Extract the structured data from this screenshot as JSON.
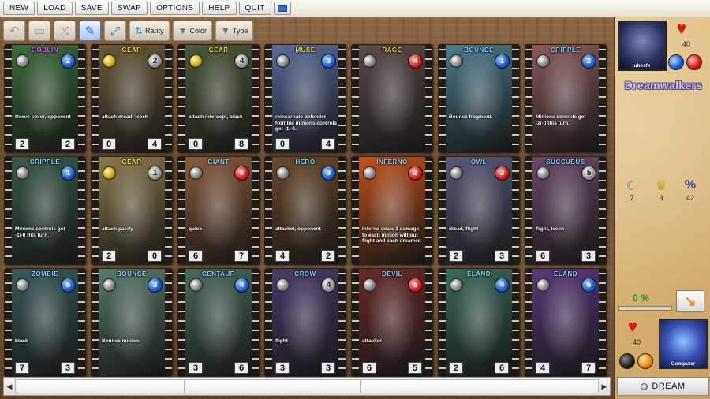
{
  "menu": [
    "NEW",
    "LOAD",
    "SAVE",
    "SWAP",
    "OPTIONS",
    "HELP",
    "QUIT"
  ],
  "toolbar": {
    "rarity_label": "Rarity",
    "color_label": "Color",
    "type_label": "Type"
  },
  "player": {
    "name": "ubesfx",
    "life": "40"
  },
  "opponent": {
    "name": "Computer",
    "life": "40"
  },
  "deck_title": "Dreamwalkers",
  "stats": {
    "moon": "7",
    "trophy": "3",
    "percent_value": "42"
  },
  "progress": {
    "label": "0 %",
    "value": 0
  },
  "dream_button": "DREAM",
  "colors": {
    "blue": "#1f5fd8",
    "red": "#d91e1e",
    "panel": "#d6b172",
    "green": "#1a8a2a"
  },
  "cards": [
    {
      "name": "GOBLIN",
      "orb": "gray",
      "cost": "2",
      "cost_color": "blue",
      "text": "thieve cover, opponent",
      "atk": "2",
      "def": "2",
      "bg": "#3c6b3a",
      "name_color": "#e05cff"
    },
    {
      "name": "GEAR",
      "orb": "yellow",
      "cost": "2",
      "cost_color": "gray",
      "text": "attach dread, leech",
      "atk": "0",
      "def": "4",
      "bg": "#6a5a3a",
      "name_color": "#ffd84a"
    },
    {
      "name": "GEAR",
      "orb": "yellow",
      "cost": "4",
      "cost_color": "gray",
      "text": "attach intercept, black",
      "atk": "0",
      "def": "8",
      "bg": "#4a5a3a",
      "name_color": "#ffd84a"
    },
    {
      "name": "MUSE",
      "orb": "gray",
      "cost": "3",
      "cost_color": "blue",
      "text": "reincarnate defender Nombie minions controls get -1/-0.",
      "atk": "0",
      "def": "4",
      "bg": "#5a6a9a",
      "name_color": "#ffd84a"
    },
    {
      "name": "RAGE",
      "orb": "gray",
      "cost": "4",
      "cost_color": "red",
      "text": "",
      "atk": "",
      "def": "",
      "bg": "#5a4a4a",
      "name_color": "#ffd84a"
    },
    {
      "name": "BOUNCE",
      "orb": "gray",
      "cost": "1",
      "cost_color": "blue",
      "text": "Bounce fragment.",
      "atk": "",
      "def": "",
      "bg": "#4a7a8a",
      "name_color": "#7fd4ff"
    },
    {
      "name": "CRIPPLE",
      "orb": "gray",
      "cost": "2",
      "cost_color": "blue",
      "text": "Minions controls get -2/-0 this turn.",
      "atk": "",
      "def": "",
      "bg": "#8a5a5a",
      "name_color": "#7fd4ff"
    },
    {
      "name": "CRIPPLE",
      "orb": "gray",
      "cost": "1",
      "cost_color": "blue",
      "text": "Minions controls get -1/-0 this turn.",
      "atk": "",
      "def": "",
      "bg": "#3a5a4a",
      "name_color": "#7fd4ff"
    },
    {
      "name": "GEAR",
      "orb": "yellow",
      "cost": "1",
      "cost_color": "gray",
      "text": "attach pacify",
      "atk": "2",
      "def": "0",
      "bg": "#8a7a4a",
      "name_color": "#ffd84a"
    },
    {
      "name": "GIANT",
      "orb": "gray",
      "cost": "6",
      "cost_color": "red",
      "text": "quick",
      "atk": "6",
      "def": "7",
      "bg": "#8a5a3a",
      "name_color": "#7fd4ff"
    },
    {
      "name": "HERO",
      "orb": "gray",
      "cost": "3",
      "cost_color": "blue",
      "text": "attacker, opponent",
      "atk": "4",
      "def": "2",
      "bg": "#6a4a2a",
      "name_color": "#7fd4ff"
    },
    {
      "name": "INFERNO",
      "orb": "gray",
      "cost": "2",
      "cost_color": "red",
      "text": "Inferno deals 2 damage to each minion without flight and each dreamer.",
      "atk": "",
      "def": "",
      "bg": "#c5501a",
      "name_color": "#7fd4ff"
    },
    {
      "name": "OWL",
      "orb": "gray",
      "cost": "3",
      "cost_color": "red",
      "text": "dread, flight",
      "atk": "2",
      "def": "3",
      "bg": "#5a5a7a",
      "name_color": "#7fd4ff"
    },
    {
      "name": "SUCCUBUS",
      "orb": "gray",
      "cost": "5",
      "cost_color": "gray",
      "text": "flight, leech",
      "atk": "6",
      "def": "3",
      "bg": "#6a4a6a",
      "name_color": "#7fd4ff"
    },
    {
      "name": "ZOMBIE",
      "orb": "gray",
      "cost": "5",
      "cost_color": "blue",
      "text": "black",
      "atk": "7",
      "def": "3",
      "bg": "#3a5a5a",
      "name_color": "#7fd4ff"
    },
    {
      "name": "BOUNCE",
      "orb": "gray",
      "cost": "3",
      "cost_color": "blue",
      "text": "Bounce minion.",
      "atk": "",
      "def": "",
      "bg": "#5a7a6a",
      "name_color": "#7fd4ff"
    },
    {
      "name": "CENTAUR",
      "orb": "gray",
      "cost": "4",
      "cost_color": "blue",
      "text": "",
      "atk": "3",
      "def": "6",
      "bg": "#4a6a5a",
      "name_color": "#7fd4ff"
    },
    {
      "name": "CROW",
      "orb": "gray",
      "cost": "4",
      "cost_color": "gray",
      "text": "flight",
      "atk": "3",
      "def": "3",
      "bg": "#4a3a6a",
      "name_color": "#7fd4ff"
    },
    {
      "name": "DEVIL",
      "orb": "gray",
      "cost": "5",
      "cost_color": "red",
      "text": "attacker",
      "atk": "6",
      "def": "5",
      "bg": "#6a2a2a",
      "name_color": "#7fd4ff"
    },
    {
      "name": "ELAND",
      "orb": "gray",
      "cost": "4",
      "cost_color": "blue",
      "text": "",
      "atk": "2",
      "def": "6",
      "bg": "#3a6a5a",
      "name_color": "#7fd4ff"
    },
    {
      "name": "ELAND",
      "orb": "gray",
      "cost": "5",
      "cost_color": "blue",
      "text": "",
      "atk": "4",
      "def": "7",
      "bg": "#5a3a7a",
      "name_color": "#7fd4ff"
    }
  ]
}
